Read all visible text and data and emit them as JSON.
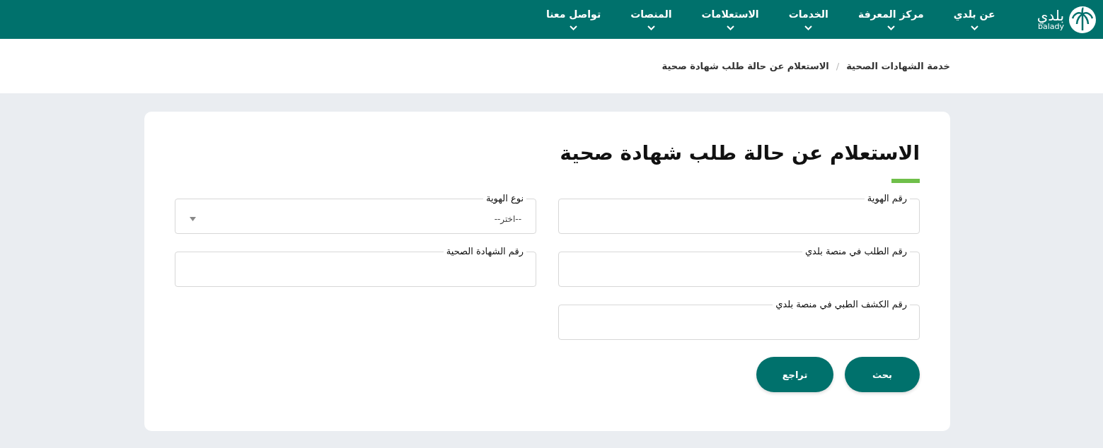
{
  "header": {
    "logo": {
      "arabic": "بلدي",
      "latin": "balady"
    },
    "nav": [
      {
        "label": "عن بلدي"
      },
      {
        "label": "مركز المعرفة"
      },
      {
        "label": "الخدمات"
      },
      {
        "label": "الاستعلامات"
      },
      {
        "label": "المنصات"
      },
      {
        "label": "تواصل معنا"
      }
    ]
  },
  "breadcrumb": {
    "separator": "/",
    "items": [
      {
        "label": "خدمة الشهادات الصحية"
      },
      {
        "label": "الاستعلام عن حالة طلب شهادة صحية"
      }
    ]
  },
  "form": {
    "title": "الاستعلام عن حالة طلب شهادة صحية",
    "fields": [
      {
        "kind": "text",
        "label": "رقم الهوية"
      },
      {
        "kind": "select",
        "label": "نوع الهوية",
        "value": "--اختر--"
      },
      {
        "kind": "text",
        "label": "رقم الطلب في منصة بلدي"
      },
      {
        "kind": "text",
        "label": "رقم الشهادة الصحية"
      },
      {
        "kind": "text",
        "label": "رقم الكشف الطبي في منصة بلدي"
      }
    ],
    "buttons": [
      {
        "label": "بحث"
      },
      {
        "label": "تراجع"
      }
    ]
  }
}
